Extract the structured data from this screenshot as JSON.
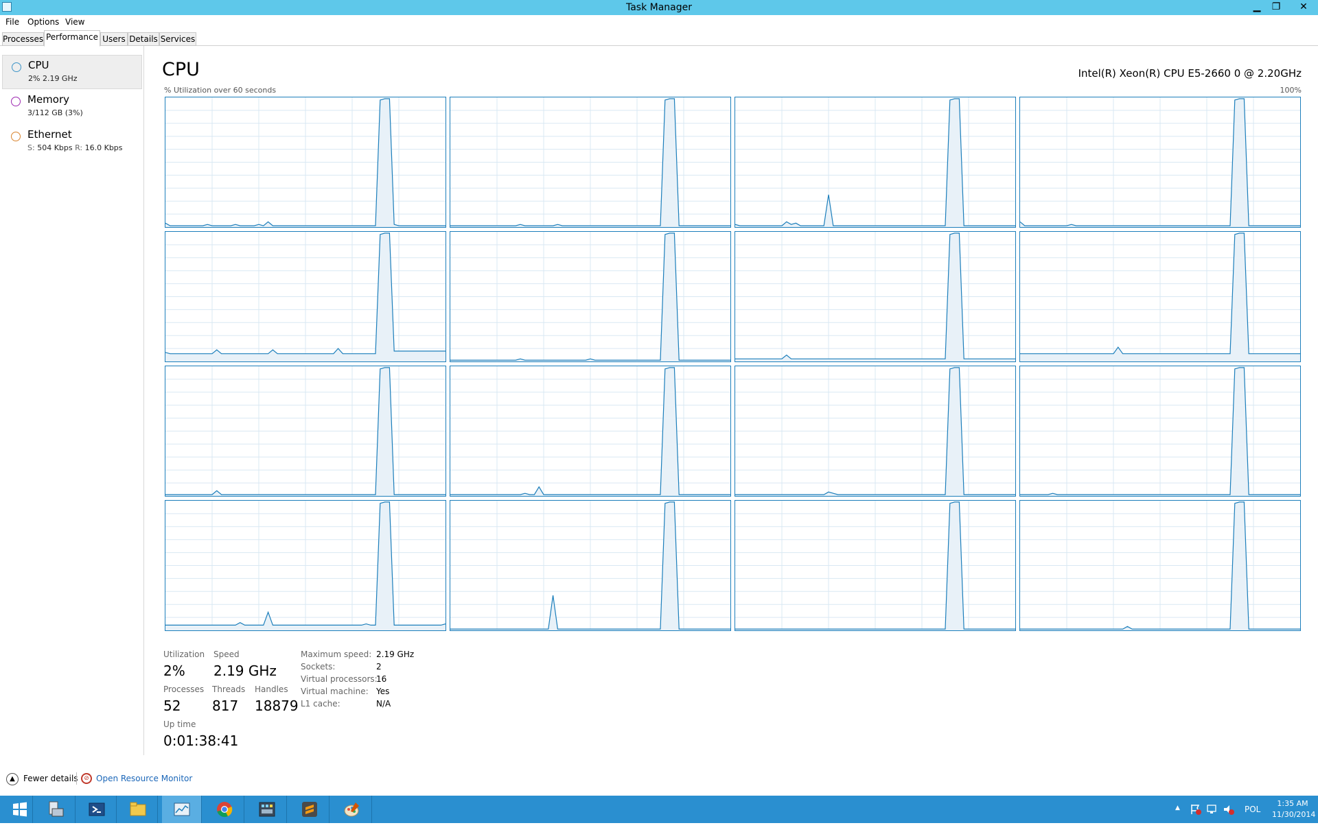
{
  "window": {
    "title": "Task Manager",
    "min": "▁",
    "max": "❐",
    "close": "✕"
  },
  "menu": [
    "File",
    "Options",
    "View"
  ],
  "tabs": [
    {
      "label": "Processes",
      "active": false
    },
    {
      "label": "Performance",
      "active": true
    },
    {
      "label": "Users",
      "active": false
    },
    {
      "label": "Details",
      "active": false
    },
    {
      "label": "Services",
      "active": false
    }
  ],
  "sidebar": {
    "items": [
      {
        "name": "CPU",
        "sub": "2% 2.19 GHz",
        "color": "#3d94c7"
      },
      {
        "name": "Memory",
        "sub": "3/112 GB (3%)",
        "color": "#9c27b0"
      },
      {
        "name": "Ethernet",
        "sub_s_label": "S:",
        "sub_s": "504 Kbps",
        "sub_r_label": "R:",
        "sub_r": "16.0 Kbps",
        "color": "#d9822b"
      }
    ]
  },
  "main": {
    "title": "CPU",
    "model": "Intel(R) Xeon(R) CPU E5-2660 0 @ 2.20GHz",
    "graph_label": "% Utilization over 60 seconds",
    "graph_max": "100%"
  },
  "stats": {
    "utilization_label": "Utilization",
    "utilization": "2%",
    "speed_label": "Speed",
    "speed": "2.19 GHz",
    "processes_label": "Processes",
    "processes": "52",
    "threads_label": "Threads",
    "threads": "817",
    "handles_label": "Handles",
    "handles": "18879",
    "uptime_label": "Up time",
    "uptime": "0:01:38:41"
  },
  "specs": [
    {
      "label": "Maximum speed:",
      "value": "2.19 GHz"
    },
    {
      "label": "Sockets:",
      "value": "2"
    },
    {
      "label": "Virtual processors:",
      "value": "16"
    },
    {
      "label": "Virtual machine:",
      "value": "Yes"
    },
    {
      "label": "L1 cache:",
      "value": "N/A"
    }
  ],
  "footer": {
    "fewer_details": "Fewer details",
    "resource_monitor": "Open Resource Monitor"
  },
  "taskbar": {
    "apps": [
      "start-icon",
      "server-manager-icon",
      "powershell-icon",
      "file-explorer-icon",
      "task-manager-icon",
      "chrome-icon",
      "network-tool-icon",
      "sublime-text-icon",
      "paint-icon"
    ],
    "language": "POL",
    "time": "1:35 AM",
    "date": "11/30/2014"
  },
  "colors": {
    "graph_line": "#1b7ebb",
    "graph_fill": "#e8f1f8",
    "grid": "#d9e8f3",
    "titlebar": "#5ec8ea",
    "taskbar": "#2a8fd0"
  },
  "chart_data": {
    "type": "line",
    "title": "",
    "xlabel": "",
    "ylabel": "% Utilization over 60 seconds",
    "ylim": [
      0,
      100
    ],
    "xlim": [
      0,
      60
    ],
    "note_panels": 16,
    "series": [
      {
        "values": [
          3,
          1,
          1,
          1,
          1,
          1,
          1,
          1,
          1,
          2,
          1,
          1,
          1,
          1,
          1,
          2,
          1,
          1,
          1,
          1,
          2,
          1,
          4,
          1,
          1,
          1,
          1,
          1,
          1,
          1,
          1,
          1,
          1,
          1,
          1,
          1,
          1,
          1,
          1,
          1,
          1,
          1,
          1,
          1,
          1,
          1,
          98,
          99,
          99,
          2,
          1,
          1,
          1,
          1,
          1,
          1,
          1,
          1,
          1,
          1,
          1
        ]
      },
      {
        "values": [
          1,
          1,
          1,
          1,
          1,
          1,
          1,
          1,
          1,
          1,
          1,
          1,
          1,
          1,
          1,
          2,
          1,
          1,
          1,
          1,
          1,
          1,
          1,
          2,
          1,
          1,
          1,
          1,
          1,
          1,
          1,
          1,
          1,
          1,
          1,
          1,
          1,
          1,
          1,
          1,
          1,
          1,
          1,
          1,
          1,
          1,
          98,
          99,
          99,
          1,
          1,
          1,
          1,
          1,
          1,
          1,
          1,
          1,
          1,
          1,
          1
        ]
      },
      {
        "values": [
          2,
          1,
          1,
          1,
          1,
          1,
          1,
          1,
          1,
          1,
          1,
          4,
          2,
          3,
          1,
          1,
          1,
          1,
          1,
          1,
          25,
          1,
          1,
          1,
          1,
          1,
          1,
          1,
          1,
          1,
          1,
          1,
          1,
          1,
          1,
          1,
          1,
          1,
          1,
          1,
          1,
          1,
          1,
          1,
          1,
          1,
          98,
          99,
          99,
          1,
          1,
          1,
          1,
          1,
          1,
          1,
          1,
          1,
          1,
          1,
          1
        ]
      },
      {
        "values": [
          4,
          1,
          1,
          1,
          1,
          1,
          1,
          1,
          1,
          1,
          1,
          2,
          1,
          1,
          1,
          1,
          1,
          1,
          1,
          1,
          1,
          1,
          1,
          1,
          1,
          1,
          1,
          1,
          1,
          1,
          1,
          1,
          1,
          1,
          1,
          1,
          1,
          1,
          1,
          1,
          1,
          1,
          1,
          1,
          1,
          1,
          98,
          99,
          99,
          1,
          1,
          1,
          1,
          1,
          1,
          1,
          1,
          1,
          1,
          1,
          1
        ]
      },
      {
        "values": [
          7,
          6,
          6,
          6,
          6,
          6,
          6,
          6,
          6,
          6,
          6,
          9,
          6,
          6,
          6,
          6,
          6,
          6,
          6,
          6,
          6,
          6,
          6,
          9,
          6,
          6,
          6,
          6,
          6,
          6,
          6,
          6,
          6,
          6,
          6,
          6,
          6,
          10,
          6,
          6,
          6,
          6,
          6,
          6,
          6,
          6,
          98,
          99,
          99,
          8,
          8,
          8,
          8,
          8,
          8,
          8,
          8,
          8,
          8,
          8,
          8
        ]
      },
      {
        "values": [
          1,
          1,
          1,
          1,
          1,
          1,
          1,
          1,
          1,
          1,
          1,
          1,
          1,
          1,
          1,
          2,
          1,
          1,
          1,
          1,
          1,
          1,
          1,
          1,
          1,
          1,
          1,
          1,
          1,
          1,
          2,
          1,
          1,
          1,
          1,
          1,
          1,
          1,
          1,
          1,
          1,
          1,
          1,
          1,
          1,
          1,
          98,
          99,
          99,
          1,
          1,
          1,
          1,
          1,
          1,
          1,
          1,
          1,
          1,
          1,
          1
        ]
      },
      {
        "values": [
          2,
          2,
          2,
          2,
          2,
          2,
          2,
          2,
          2,
          2,
          2,
          5,
          2,
          2,
          2,
          2,
          2,
          2,
          2,
          2,
          2,
          2,
          2,
          2,
          2,
          2,
          2,
          2,
          2,
          2,
          2,
          2,
          2,
          2,
          2,
          2,
          2,
          2,
          2,
          2,
          2,
          2,
          2,
          2,
          2,
          2,
          98,
          99,
          99,
          2,
          2,
          2,
          2,
          2,
          2,
          2,
          2,
          2,
          2,
          2,
          2
        ]
      },
      {
        "values": [
          6,
          6,
          6,
          6,
          6,
          6,
          6,
          6,
          6,
          6,
          6,
          6,
          6,
          6,
          6,
          6,
          6,
          6,
          6,
          6,
          6,
          11,
          6,
          6,
          6,
          6,
          6,
          6,
          6,
          6,
          6,
          6,
          6,
          6,
          6,
          6,
          6,
          6,
          6,
          6,
          6,
          6,
          6,
          6,
          6,
          6,
          98,
          99,
          99,
          6,
          6,
          6,
          6,
          6,
          6,
          6,
          6,
          6,
          6,
          6,
          6
        ]
      },
      {
        "values": [
          1,
          1,
          1,
          1,
          1,
          1,
          1,
          1,
          1,
          1,
          1,
          4,
          1,
          1,
          1,
          1,
          1,
          1,
          1,
          1,
          1,
          1,
          1,
          1,
          1,
          1,
          1,
          1,
          1,
          1,
          1,
          1,
          1,
          1,
          1,
          1,
          1,
          1,
          1,
          1,
          1,
          1,
          1,
          1,
          1,
          1,
          98,
          99,
          99,
          1,
          1,
          1,
          1,
          1,
          1,
          1,
          1,
          1,
          1,
          1,
          1
        ]
      },
      {
        "values": [
          1,
          1,
          1,
          1,
          1,
          1,
          1,
          1,
          1,
          1,
          1,
          1,
          1,
          1,
          1,
          1,
          2,
          1,
          1,
          7,
          1,
          1,
          1,
          1,
          1,
          1,
          1,
          1,
          1,
          1,
          1,
          1,
          1,
          1,
          1,
          1,
          1,
          1,
          1,
          1,
          1,
          1,
          1,
          1,
          1,
          1,
          98,
          99,
          99,
          1,
          1,
          1,
          1,
          1,
          1,
          1,
          1,
          1,
          1,
          1,
          1
        ]
      },
      {
        "values": [
          1,
          1,
          1,
          1,
          1,
          1,
          1,
          1,
          1,
          1,
          1,
          1,
          1,
          1,
          1,
          1,
          1,
          1,
          1,
          1,
          3,
          2,
          1,
          1,
          1,
          1,
          1,
          1,
          1,
          1,
          1,
          1,
          1,
          1,
          1,
          1,
          1,
          1,
          1,
          1,
          1,
          1,
          1,
          1,
          1,
          1,
          98,
          99,
          99,
          1,
          1,
          1,
          1,
          1,
          1,
          1,
          1,
          1,
          1,
          1,
          1
        ]
      },
      {
        "values": [
          1,
          1,
          1,
          1,
          1,
          1,
          1,
          2,
          1,
          1,
          1,
          1,
          1,
          1,
          1,
          1,
          1,
          1,
          1,
          1,
          1,
          1,
          1,
          1,
          1,
          1,
          1,
          1,
          1,
          1,
          1,
          1,
          1,
          1,
          1,
          1,
          1,
          1,
          1,
          1,
          1,
          1,
          1,
          1,
          1,
          1,
          98,
          99,
          99,
          1,
          1,
          1,
          1,
          1,
          1,
          1,
          1,
          1,
          1,
          1,
          1
        ]
      },
      {
        "values": [
          4,
          4,
          4,
          4,
          4,
          4,
          4,
          4,
          4,
          4,
          4,
          4,
          4,
          4,
          4,
          4,
          6,
          4,
          4,
          4,
          4,
          4,
          14,
          4,
          4,
          4,
          4,
          4,
          4,
          4,
          4,
          4,
          4,
          4,
          4,
          4,
          4,
          4,
          4,
          4,
          4,
          4,
          4,
          5,
          4,
          4,
          98,
          99,
          99,
          4,
          4,
          4,
          4,
          4,
          4,
          4,
          4,
          4,
          4,
          4,
          5
        ]
      },
      {
        "values": [
          1,
          1,
          1,
          1,
          1,
          1,
          1,
          1,
          1,
          1,
          1,
          1,
          1,
          1,
          1,
          1,
          1,
          1,
          1,
          1,
          1,
          1,
          27,
          1,
          1,
          1,
          1,
          1,
          1,
          1,
          1,
          1,
          1,
          1,
          1,
          1,
          1,
          1,
          1,
          1,
          1,
          1,
          1,
          1,
          1,
          1,
          98,
          99,
          99,
          1,
          1,
          1,
          1,
          1,
          1,
          1,
          1,
          1,
          1,
          1,
          1
        ]
      },
      {
        "values": [
          1,
          1,
          1,
          1,
          1,
          1,
          1,
          1,
          1,
          1,
          1,
          1,
          1,
          1,
          1,
          1,
          1,
          1,
          1,
          1,
          1,
          1,
          1,
          1,
          1,
          1,
          1,
          1,
          1,
          1,
          1,
          1,
          1,
          1,
          1,
          1,
          1,
          1,
          1,
          1,
          1,
          1,
          1,
          1,
          1,
          1,
          98,
          99,
          99,
          1,
          1,
          1,
          1,
          1,
          1,
          1,
          1,
          1,
          1,
          1,
          1
        ]
      },
      {
        "values": [
          1,
          1,
          1,
          1,
          1,
          1,
          1,
          1,
          1,
          1,
          1,
          1,
          1,
          1,
          1,
          1,
          1,
          1,
          1,
          1,
          1,
          1,
          1,
          3,
          1,
          1,
          1,
          1,
          1,
          1,
          1,
          1,
          1,
          1,
          1,
          1,
          1,
          1,
          1,
          1,
          1,
          1,
          1,
          1,
          1,
          1,
          98,
          99,
          99,
          1,
          1,
          1,
          1,
          1,
          1,
          1,
          1,
          1,
          1,
          1,
          1
        ]
      }
    ]
  }
}
